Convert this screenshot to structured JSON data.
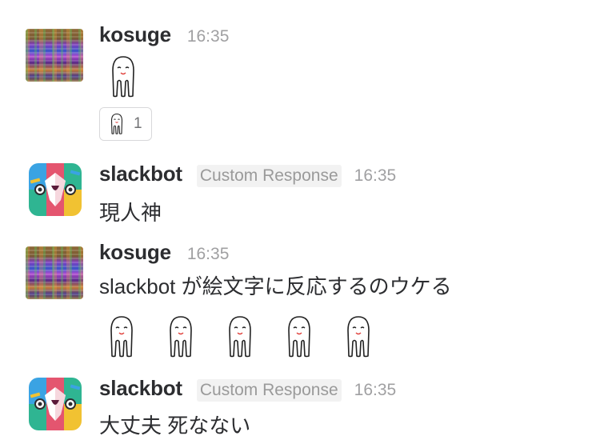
{
  "messages": [
    {
      "user": "kosuge",
      "time": "16:35",
      "emoji": "ghost-emoji",
      "reaction": {
        "emoji": "ghost-emoji",
        "count": "1"
      }
    },
    {
      "user": "slackbot",
      "badge": "Custom Response",
      "time": "16:35",
      "text": "現人神"
    },
    {
      "user": "kosuge",
      "time": "16:35",
      "text": "slackbot が絵文字に反応するのウケる",
      "emoji_count": 5
    },
    {
      "user": "slackbot",
      "badge": "Custom Response",
      "time": "16:35",
      "text": "大丈夫 死なない"
    }
  ],
  "colors": {
    "text": "#2c2d30",
    "timestamp": "#a0a0a2",
    "badge_bg": "#f2f2f2",
    "badge_text": "#9a9a9a",
    "reaction_border": "#d8d8da",
    "slackbot_pink": "#e4556f",
    "slackbot_yellow": "#f1c232",
    "slackbot_teal": "#2fb592",
    "slackbot_blue": "#3aa3e3"
  }
}
